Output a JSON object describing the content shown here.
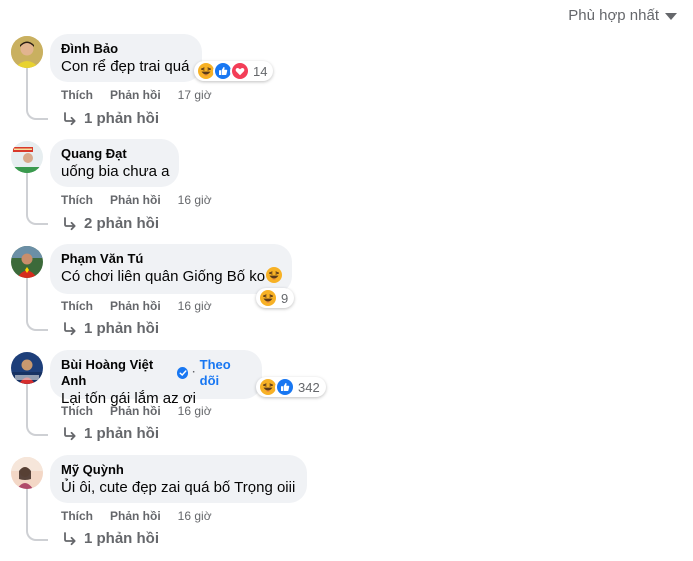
{
  "sort": {
    "label": "Phù hợp nhất"
  },
  "actions": {
    "like": "Thích",
    "reply": "Phản hồi"
  },
  "comments": [
    {
      "author": "Đình Bảo",
      "text": "Con rể đẹp trai quá",
      "time": "17 giờ",
      "reaction_count": "14",
      "reactions": [
        "haha",
        "like",
        "love"
      ],
      "replies": "1 phản hồi"
    },
    {
      "author": "Quang Đạt",
      "text": "uống bia chưa a",
      "time": "16 giờ",
      "replies": "2 phản hồi"
    },
    {
      "author": "Phạm Văn Tú",
      "text": "Có chơi liên quân Giống Bố ko",
      "text_emoji": "haha",
      "time": "16 giờ",
      "reaction_count": "9",
      "reactions": [
        "haha"
      ],
      "replies": "1 phản hồi"
    },
    {
      "author": "Bùi Hoàng Việt Anh",
      "verified": true,
      "follow": "Theo dõi",
      "text": "Lại tốn gái lắm az ơi",
      "time": "16 giờ",
      "reaction_count": "342",
      "reactions": [
        "haha",
        "like"
      ],
      "replies": "1 phản hồi"
    },
    {
      "author": "Mỹ Quỳnh",
      "text": "Ủi ôi, cute đẹp zai quá bố Trọng oiii",
      "time": "16 giờ",
      "replies": "1 phản hồi"
    }
  ],
  "colors": {
    "bubble": "#f0f2f5",
    "secondary_text": "#65676b",
    "link": "#1877f2",
    "haha": "#f7b125",
    "like": "#1877f2",
    "love": "#f33e58"
  }
}
